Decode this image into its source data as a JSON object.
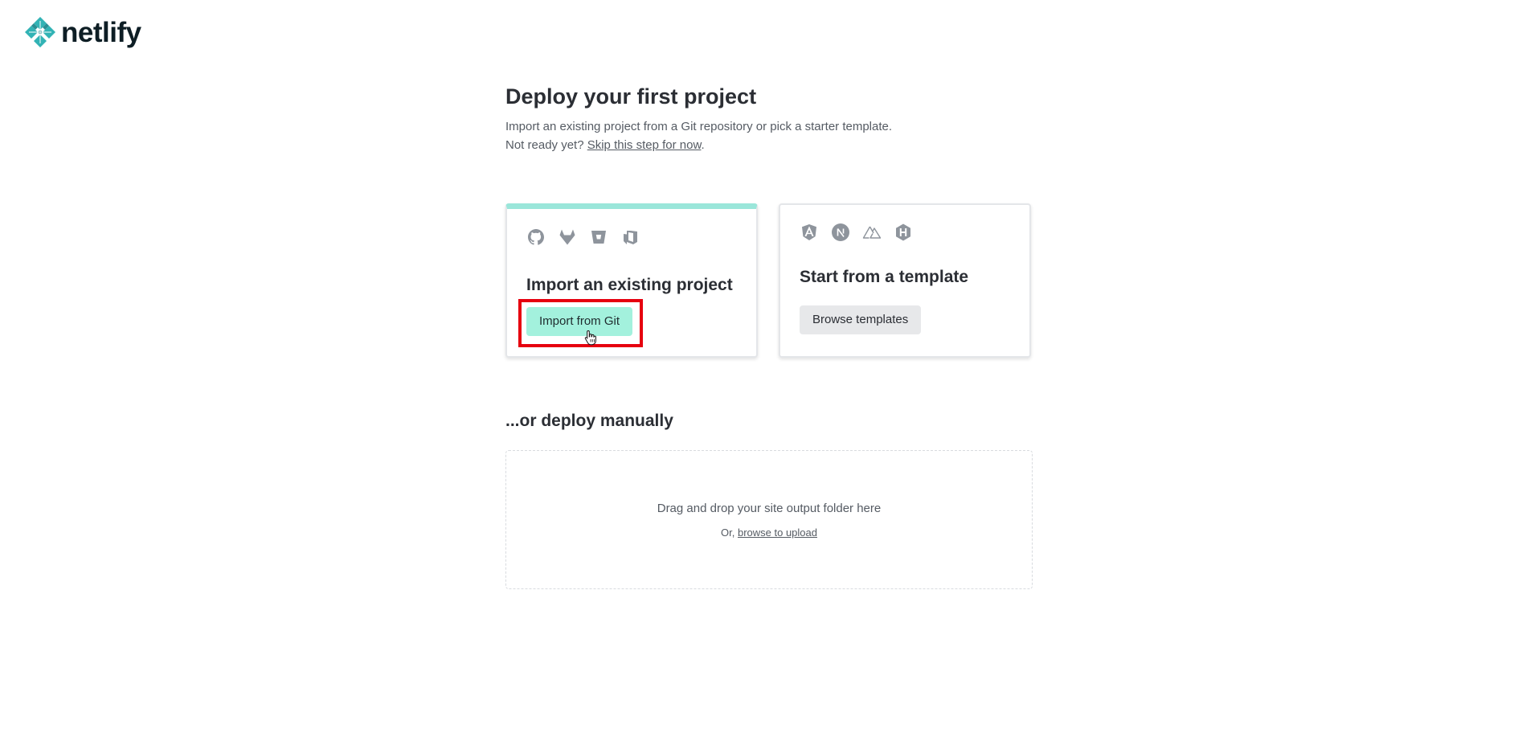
{
  "brand": {
    "name": "netlify",
    "logo_icon": "netlify-logo-icon",
    "logo_color": "#32b3b5"
  },
  "header": {
    "title": "Deploy your first project",
    "description": "Import an existing project from a Git repository or pick a starter template.",
    "not_ready_prefix": "Not ready yet? ",
    "skip_link": "Skip this step for now",
    "not_ready_suffix": "."
  },
  "cards": {
    "import": {
      "title": "Import an existing project",
      "button_label": "Import from Git",
      "icons": [
        "github-icon",
        "gitlab-icon",
        "bitbucket-icon",
        "azure-devops-icon"
      ],
      "accent_color": "#9ae6da",
      "button_color": "#a3f1dd"
    },
    "template": {
      "title": "Start from a template",
      "button_label": "Browse templates",
      "icons": [
        "angular-icon",
        "nextjs-icon",
        "nuxt-icon",
        "hugo-icon"
      ]
    }
  },
  "manual": {
    "title": "...or deploy manually",
    "drop_text": "Drag and drop your site output folder here",
    "or_prefix": "Or, ",
    "browse_link": "browse to upload"
  },
  "colors": {
    "highlight": "#e6000f",
    "icon_gray": "#8e949c"
  }
}
